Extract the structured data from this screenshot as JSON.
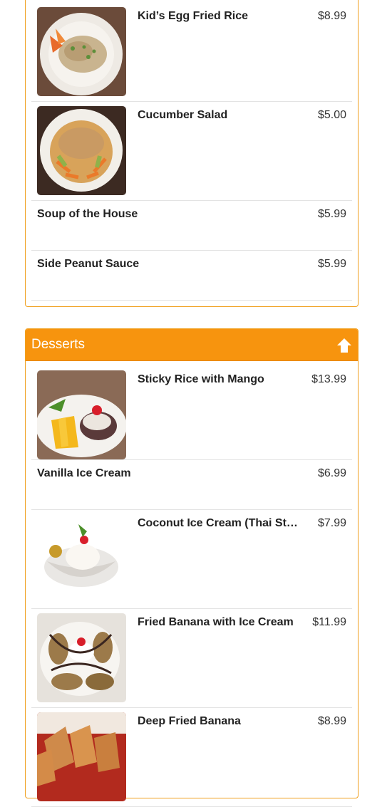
{
  "top_section": {
    "items": [
      {
        "name": "Kid’s Egg Fried Rice",
        "price": "$8.99"
      },
      {
        "name": "Cucumber Salad",
        "price": "$5.00"
      },
      {
        "name": "Soup of the House",
        "price": "$5.99"
      },
      {
        "name": "Side Peanut Sauce",
        "price": "$5.99"
      }
    ]
  },
  "desserts": {
    "title": "Desserts",
    "collapse_icon": "arrow-up-icon",
    "items": [
      {
        "name": "Sticky Rice with Mango",
        "price": "$13.99"
      },
      {
        "name": "Vanilla Ice Cream",
        "price": "$6.99"
      },
      {
        "name": "Coconut Ice Cream (Thai Style)",
        "price": "$7.99"
      },
      {
        "name": "Fried Banana with Ice Cream",
        "price": "$11.99"
      },
      {
        "name": "Deep Fried Banana",
        "price": "$8.99"
      }
    ]
  },
  "colors": {
    "accent": "#f7940e",
    "border": "#f0a01e"
  }
}
